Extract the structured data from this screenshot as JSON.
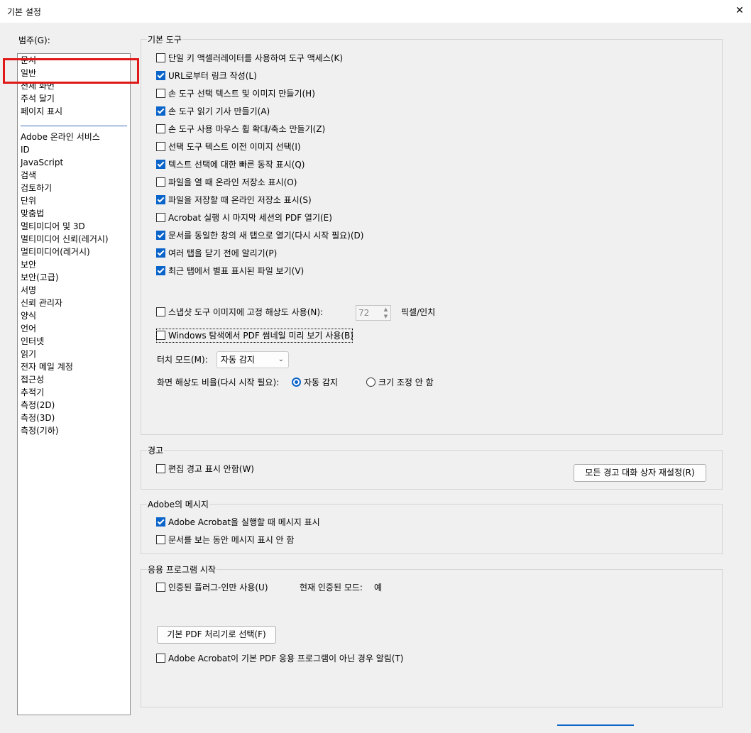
{
  "window": {
    "title": "기본 설정",
    "close": "✕"
  },
  "category": {
    "label": "범주(G):",
    "top_items": [
      "문서",
      "일반",
      "전체 화면",
      "주석 달기",
      "페이지 표시"
    ],
    "items": [
      "Adobe 온라인 서비스",
      "ID",
      "JavaScript",
      "검색",
      "검토하기",
      "단위",
      "맞춤법",
      "멀티미디어 및 3D",
      "멀티미디어 신뢰(레거시)",
      "멀티미디어(레거시)",
      "보안",
      "보안(고급)",
      "서명",
      "신뢰 관리자",
      "양식",
      "언어",
      "인터넷",
      "읽기",
      "전자 메일 계정",
      "접근성",
      "추적기",
      "측정(2D)",
      "측정(3D)",
      "측정(기하)"
    ]
  },
  "basic_tools": {
    "label": "기본 도구",
    "checkboxes": [
      {
        "label": "단일 키 액셀러레이터를 사용하여 도구 액세스(K)",
        "checked": false
      },
      {
        "label": "URL로부터 링크 작성(L)",
        "checked": true
      },
      {
        "label": "손 도구 선택 텍스트 및 이미지 만들기(H)",
        "checked": false
      },
      {
        "label": "손 도구 읽기 기사 만들기(A)",
        "checked": true
      },
      {
        "label": "손 도구 사용 마우스 휠 확대/축소 만들기(Z)",
        "checked": false
      },
      {
        "label": "선택 도구 텍스트 이전 이미지 선택(I)",
        "checked": false
      },
      {
        "label": "텍스트 선택에 대한 빠른 동작 표시(Q)",
        "checked": true
      },
      {
        "label": "파일을 열 때 온라인 저장소 표시(O)",
        "checked": false
      },
      {
        "label": "파일을 저장할 때 온라인 저장소 표시(S)",
        "checked": true
      },
      {
        "label": "Acrobat 실행 시 마지막 세션의 PDF 열기(E)",
        "checked": false
      },
      {
        "label": "문서를 동일한 창의 새 탭으로 열기(다시 시작 필요)(D)",
        "checked": true
      },
      {
        "label": "여러 탭을 닫기 전에 알리기(P)",
        "checked": true
      },
      {
        "label": "최근 탭에서 별표 표시된 파일 보기(V)",
        "checked": true
      }
    ],
    "snapshot": {
      "label": "스냅샷 도구 이미지에 고정 해상도 사용(N):",
      "checked": false,
      "value": "72",
      "unit": "픽셀/인치"
    },
    "thumbnail": {
      "label": "Windows 탐색에서 PDF 썸네일 미리 보기 사용(B)",
      "checked": false
    },
    "touch_mode": {
      "label": "터치 모드(M):",
      "value": "자동 감지"
    },
    "screen_ratio": {
      "label": "화면 해상도 비율(다시 시작 필요):",
      "option_auto": "자동 감지",
      "option_none": "크기 조정 안 함"
    }
  },
  "warnings": {
    "label": "경고",
    "checkbox": {
      "label": "편집 경고 표시 안함(W)",
      "checked": false
    },
    "reset_button": "모든 경고 대화 상자 재설정(R)"
  },
  "adobe_messages": {
    "label": "Adobe의 메시지",
    "checkboxes": [
      {
        "label": "Adobe Acrobat을 실행할 때 메시지 표시",
        "checked": true
      },
      {
        "label": "문서를 보는 동안 메시지 표시 안 함",
        "checked": false
      }
    ]
  },
  "app_startup": {
    "label": "응용 프로그램 시작",
    "certified": {
      "label": "인증된 플러그-인만 사용(U)",
      "checked": false
    },
    "current_mode_label": "현재 인증된 모드:",
    "current_mode_value": "예",
    "default_pdf_button": "기본 PDF 처리기로 선택(F)",
    "notify": {
      "label": "Adobe Acrobat이 기본 PDF 응용 프로그램이 아닌 경우 알림(T)",
      "checked": false
    }
  }
}
